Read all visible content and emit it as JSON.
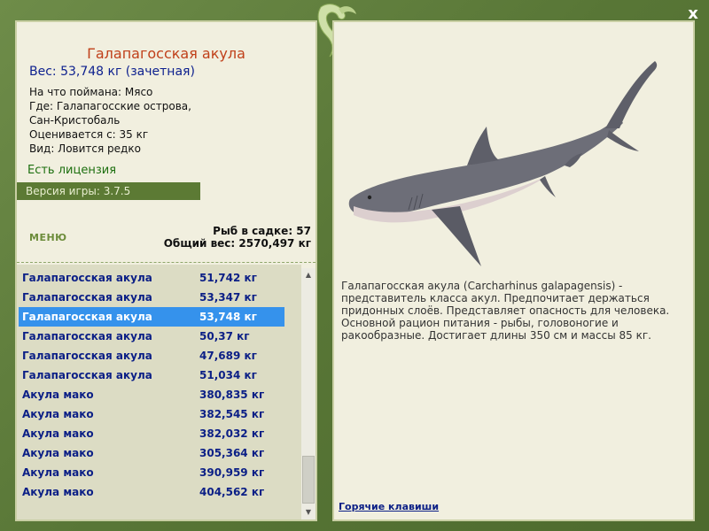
{
  "fish": {
    "title": "Галапагосская акула",
    "weight": "Вес: 53,748 кг (зачетная)",
    "info": [
      "На что поймана: Мясо",
      "Где: Галапагосские острова,",
      "Сан-Кристобаль",
      "Оценивается с: 35 кг",
      "Вид: Ловится редко"
    ],
    "license": "Есть лицензия"
  },
  "version": "Версия игры: 3.7.5",
  "menu_label": "МЕНЮ",
  "stats": {
    "count": "Рыб в садке: 57",
    "total": "Общий вес: 2570,497 кг"
  },
  "catch_list": [
    {
      "name": "Галапагосская акула",
      "weight": "51,742 кг"
    },
    {
      "name": "Галапагосская акула",
      "weight": "53,347 кг"
    },
    {
      "name": "Галапагосская акула",
      "weight": "53,748 кг"
    },
    {
      "name": "Галапагосская акула",
      "weight": "50,37 кг"
    },
    {
      "name": "Галапагосская акула",
      "weight": "47,689 кг"
    },
    {
      "name": "Галапагосская акула",
      "weight": "51,034 кг"
    },
    {
      "name": "Акула мако",
      "weight": "380,835 кг"
    },
    {
      "name": "Акула мако",
      "weight": "382,545 кг"
    },
    {
      "name": "Акула мако",
      "weight": "382,032 кг"
    },
    {
      "name": "Акула мако",
      "weight": "305,364 кг"
    },
    {
      "name": "Акула мако",
      "weight": "390,959 кг"
    },
    {
      "name": "Акула мако",
      "weight": "404,562 кг"
    }
  ],
  "selected_index": 2,
  "description": "Галапагосская акула (Carcharhinus galapagensis) - представитель класса акул. Предпочитает держаться придонных слоёв. Представляет опасность для человека. Основной рацион питания - рыбы, головоногие и ракообразные. Достигает длины 350 см и массы 85 кг.",
  "hotkeys_label": "Горячие клавиши",
  "close_label": "x",
  "icons": {
    "close": "close-icon",
    "logo": "fish-logo-icon",
    "scroll_up": "chevron-up-icon",
    "scroll_down": "chevron-down-icon"
  },
  "colors": {
    "frame_green": "#5a7438",
    "panel_bg": "#f1efdf",
    "list_bg": "#dcdcc4",
    "selected_row": "#3592ec",
    "title_red": "#c0401a",
    "text_blue": "#0c1f86"
  }
}
